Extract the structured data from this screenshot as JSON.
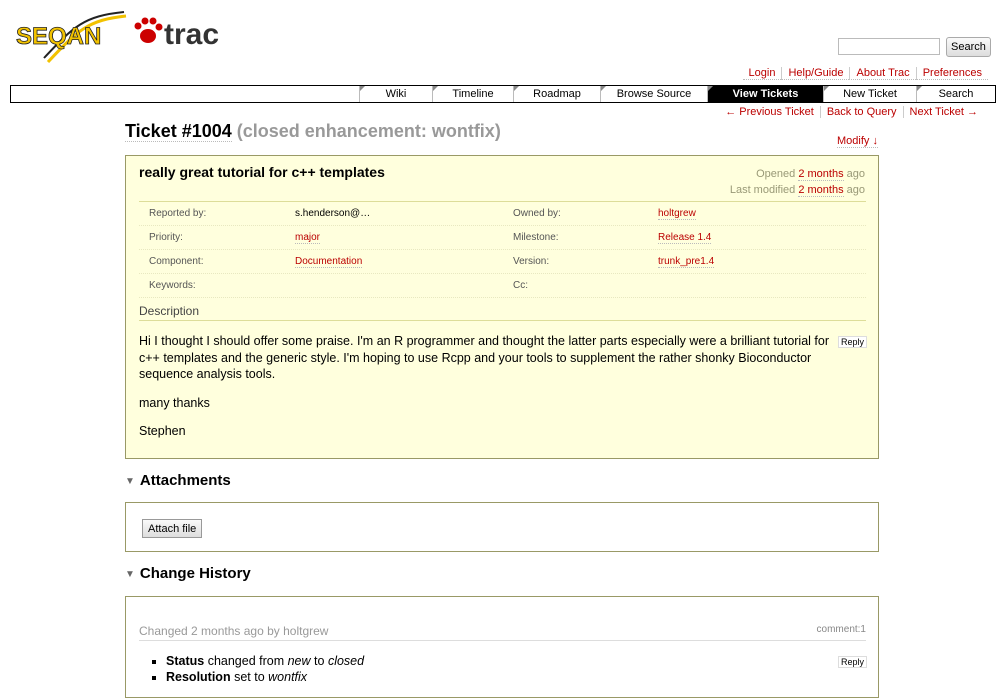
{
  "logo": {
    "seqan": "SEQAN",
    "trac": "trac"
  },
  "search": {
    "placeholder": "",
    "button_label": "Search"
  },
  "metanav": [
    "Login",
    "Help/Guide",
    "About Trac",
    "Preferences"
  ],
  "mainnav": [
    {
      "label": "Wiki",
      "width": 50
    },
    {
      "label": "Timeline",
      "width": 70
    },
    {
      "label": "Roadmap",
      "width": 85
    },
    {
      "label": "Browse Source",
      "width": 90
    },
    {
      "label": "View Tickets",
      "width": 115,
      "active": true
    },
    {
      "label": "New Ticket",
      "width": 95
    },
    {
      "label": "Search",
      "width": 72
    }
  ],
  "ctxtnav": [
    "← Previous Ticket",
    "Back to Query",
    "Next Ticket →"
  ],
  "ticket": {
    "number": "Ticket #1004",
    "status": "(closed enhancement: wontfix)",
    "modify": "Modify ↓",
    "summary": "really great tutorial for c++ templates",
    "opened_label": "Opened",
    "opened_value": "2 months",
    "opened_suffix": "ago",
    "modified_label": "Last modified",
    "modified_value": "2 months",
    "modified_suffix": "ago",
    "props": {
      "reported_by_label": "Reported by:",
      "reported_by": "s.henderson@…",
      "owned_by_label": "Owned by:",
      "owned_by": "holtgrew",
      "priority_label": "Priority:",
      "priority": "major",
      "milestone_label": "Milestone:",
      "milestone": "Release 1.4",
      "component_label": "Component:",
      "component": "Documentation",
      "version_label": "Version:",
      "version": "trunk_pre1.4",
      "keywords_label": "Keywords:",
      "keywords": "",
      "cc_label": "Cc:",
      "cc": ""
    },
    "description_heading": "Description",
    "description": [
      "Hi I thought I should offer some praise. I'm an R programmer and thought the latter parts especially were a brilliant tutorial for c++ templates and the generic style. I'm hoping to use Rcpp and your tools to supplement the rather shonky Bioconductor sequence analysis tools.",
      "many thanks",
      "Stephen"
    ],
    "reply_label": "Reply"
  },
  "attachments": {
    "heading": "Attachments",
    "button": "Attach file"
  },
  "history": {
    "heading": "Change History",
    "change_header": "Changed 2 months ago by holtgrew",
    "comment_no": "comment:1",
    "reply_label": "Reply",
    "changes": [
      {
        "field": "Status",
        "text1": "changed from",
        "old": "new",
        "text2": "to",
        "new": "closed"
      },
      {
        "field": "Resolution",
        "text1": "set to",
        "old": "",
        "text2": "",
        "new": "wontfix"
      }
    ]
  }
}
